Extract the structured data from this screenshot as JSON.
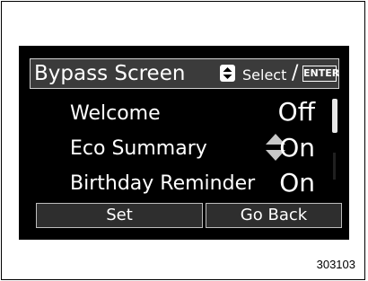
{
  "header": {
    "title": "Bypass Screen",
    "updown_icon": "up-down-key-icon",
    "select_label": "Select",
    "separator": "/",
    "enter_key_label": "ENTER"
  },
  "rows": [
    {
      "label": "Welcome",
      "value": "Off"
    },
    {
      "label": "Eco Summary",
      "value": "On"
    },
    {
      "label": "Birthday Reminder",
      "value": "On"
    }
  ],
  "scroll_icon": "up-down-arrows-icon",
  "buttons": {
    "set_label": "Set",
    "back_label": "Go Back"
  },
  "figure_id": "303103",
  "colors": {
    "screen_bg": "#000000",
    "header_bg": "#3b3b3b",
    "button_bg": "#2e2e2e",
    "text": "#ffffff",
    "arrow": "#c8c8c8"
  }
}
